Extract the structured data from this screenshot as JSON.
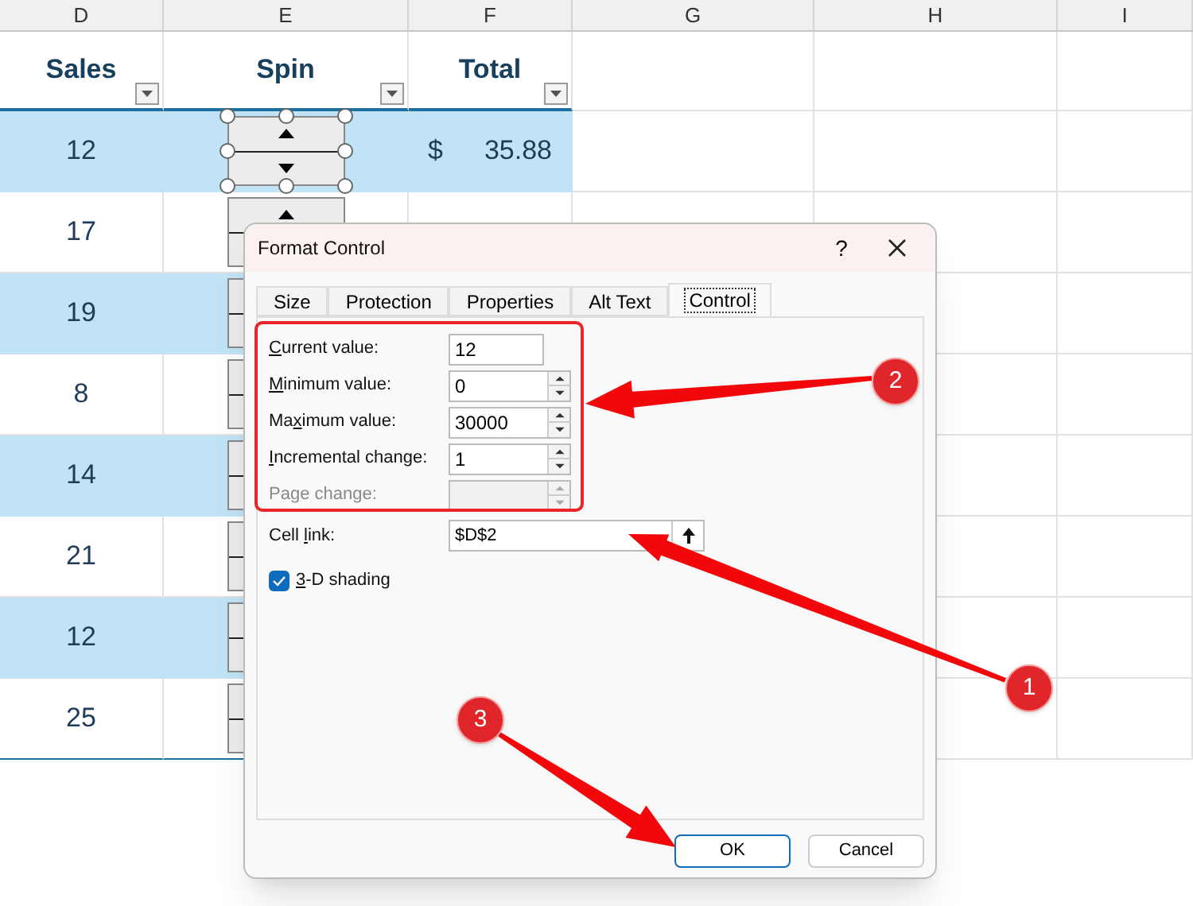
{
  "sheet": {
    "column_headers": [
      "D",
      "E",
      "F",
      "G",
      "H",
      "I"
    ],
    "table_headers": [
      "Sales",
      "Spin",
      "Total"
    ],
    "rows": [
      {
        "sales": "12",
        "shaded": true,
        "spin_selected": true,
        "currency": "$",
        "total": "35.88"
      },
      {
        "sales": "17",
        "shaded": false,
        "spin_selected": false
      },
      {
        "sales": "19",
        "shaded": true,
        "spin_selected": false
      },
      {
        "sales": "8",
        "shaded": false,
        "spin_selected": false
      },
      {
        "sales": "14",
        "shaded": true,
        "spin_selected": false
      },
      {
        "sales": "21",
        "shaded": false,
        "spin_selected": false
      },
      {
        "sales": "12",
        "shaded": true,
        "spin_selected": false
      },
      {
        "sales": "25",
        "shaded": false,
        "spin_selected": false
      }
    ]
  },
  "dialog": {
    "title": "Format Control",
    "help": "?",
    "tabs": [
      {
        "label": "Size",
        "selected": false
      },
      {
        "label": "Protection",
        "selected": false
      },
      {
        "label": "Properties",
        "selected": false
      },
      {
        "label": "Alt Text",
        "selected": false
      },
      {
        "label": "Control",
        "selected": true
      }
    ],
    "fields": [
      {
        "kind": "input",
        "label": {
          "key": "C",
          "post": "urrent value:"
        },
        "value": "12",
        "disabled": false
      },
      {
        "kind": "spinner",
        "label": {
          "key": "M",
          "post": "inimum value:"
        },
        "value": "0",
        "disabled": false
      },
      {
        "kind": "spinner",
        "label": {
          "pre": "Ma",
          "key": "x",
          "post": "imum value:"
        },
        "value": "30000",
        "disabled": false
      },
      {
        "kind": "spinner",
        "label": {
          "key": "I",
          "post": "ncremental change:"
        },
        "value": "1",
        "disabled": false
      },
      {
        "kind": "spinner",
        "label": {
          "pre": "Pa",
          "key": "g",
          "post": "e change:"
        },
        "disabled": true
      }
    ],
    "cell_link": {
      "label": {
        "pre": "Cell ",
        "key": "l",
        "post": "ink:"
      },
      "value": "$D$2"
    },
    "checkbox": {
      "label": {
        "key": "3",
        "post": "-D shading"
      },
      "checked": true
    },
    "buttons": [
      {
        "label": "OK",
        "default": true
      },
      {
        "label": "Cancel",
        "default": false
      }
    ]
  },
  "callouts": [
    {
      "number": "2"
    },
    {
      "number": "1"
    },
    {
      "number": "3"
    }
  ]
}
